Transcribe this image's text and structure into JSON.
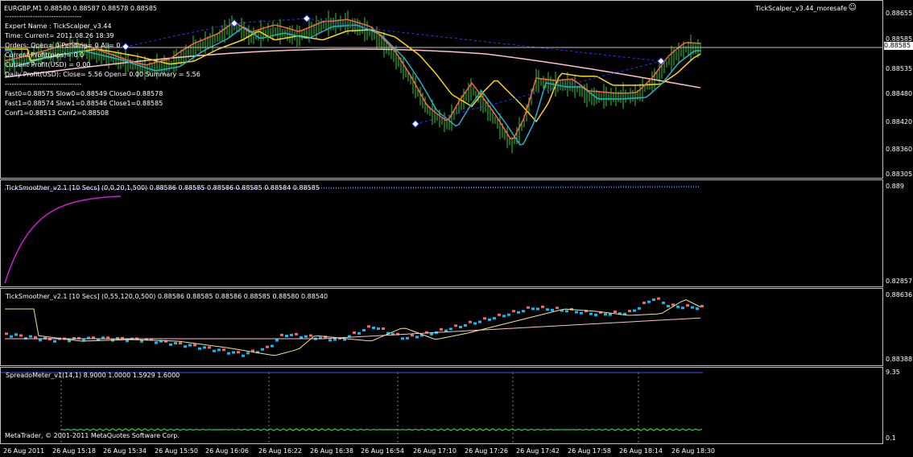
{
  "main": {
    "symbol_line": "EURGBP,M1  0.88580 0.88587 0.88578 0.88585",
    "expert_label": "TickScalper_v3.44_moresafe",
    "info_lines": [
      "---------------------------------",
      "Expert Name : TickScalper_v3.44",
      "Time: Current= 2011.08.26 18:39",
      "Orders: Open= 0 Pending= 0 All= 0",
      "Current Profit(pips)= 0.0",
      "Current Profit(USD) = 0.00",
      "Daily Profit(USD): Close= 5.56 Open= 0.00 Summary = 5.56",
      "---------------------------------",
      "Fast0=0.88575 Slow0=0.88549 Close0=0.88578",
      "Fast1=0.88574 Slow1=0.88546 Close1=0.88585",
      "Conf1=0.88513 Conf2=0.88508"
    ],
    "price_ticks": [
      "0.88655",
      "0.88585",
      "0.88535",
      "0.88480",
      "0.88420",
      "0.88360",
      "0.88305"
    ],
    "last_price": "0.88585"
  },
  "ind1": {
    "title": "TickSmoother_v2.1 [10 Secs] (0,0,20,1,500) 0.88586 0.88585 0.88586 0.88585 0.88584 0.88585",
    "ticks": [
      "0.889",
      "0.82857"
    ]
  },
  "ind2": {
    "title": "TickSmoother_v2.1 [10 Secs] (0,55,120,0,500) 0.88586 0.88585 0.88586 0.88585 0.88580 0.88540",
    "ticks": [
      "0.88636",
      "0.88388"
    ]
  },
  "ind3": {
    "title": "SpreadoMeter_v1(14,1) 8.9000 1.0000 1.5929 1.6000",
    "ticks": [
      "9.35",
      "0.1"
    ]
  },
  "copyright": "MetaTrader, © 2001-2011 MetaQuotes Software Corp.",
  "x_labels": [
    "26 Aug 2011",
    "26 Aug 15:18",
    "26 Aug 15:34",
    "26 Aug 15:50",
    "26 Aug 16:06",
    "26 Aug 16:22",
    "26 Aug 16:38",
    "26 Aug 16:54",
    "26 Aug 17:10",
    "26 Aug 17:26",
    "26 Aug 17:42",
    "26 Aug 17:58",
    "26 Aug 18:14",
    "26 Aug 18:30"
  ],
  "colors": {
    "bull": "#32cd32",
    "fast": "#ff6347",
    "mid": "#1fb5d1",
    "slow": "#ffd700",
    "conf": "#ffc0cb",
    "trend": "#1e3cff",
    "sm_up": "#00bfff",
    "sm_dn": "#ff6060",
    "spread": "#32cd32"
  }
}
